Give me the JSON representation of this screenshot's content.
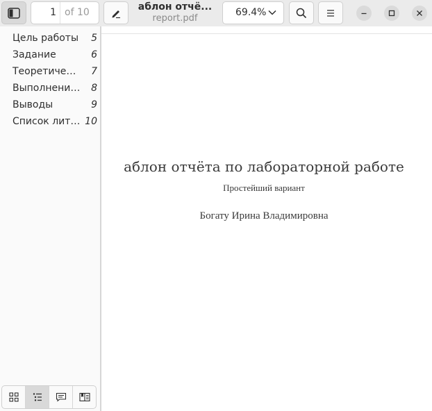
{
  "header": {
    "current_page": "1",
    "page_total_label": "of 10",
    "title": "аблон отчё...",
    "subtitle": "report.pdf",
    "zoom": "69.4%"
  },
  "sidebar": {
    "outline": [
      {
        "label": "Цель работы",
        "page": "5"
      },
      {
        "label": "Задание",
        "page": "6"
      },
      {
        "label": "Теоретическая часть",
        "page": "7"
      },
      {
        "label": "Выполнение работы",
        "page": "8"
      },
      {
        "label": "Выводы",
        "page": "9"
      },
      {
        "label": "Список литературы",
        "page": "10"
      }
    ],
    "tabs": [
      {
        "icon": "thumbnails-icon",
        "active": false
      },
      {
        "icon": "outline-icon",
        "active": true
      },
      {
        "icon": "annotations-icon",
        "active": false
      },
      {
        "icon": "bookmarks-icon",
        "active": false
      }
    ]
  },
  "document": {
    "title": "аблон отчёта по лабораторной работе",
    "subtitle": "Простейший вариант",
    "author": "Богату Ирина Владимировна"
  },
  "colors": {
    "header_bg": "#ebebeb",
    "sidebar_bg": "#fafafa",
    "page_bg": "#ffffff",
    "active_tab": "#d9d9d9"
  }
}
